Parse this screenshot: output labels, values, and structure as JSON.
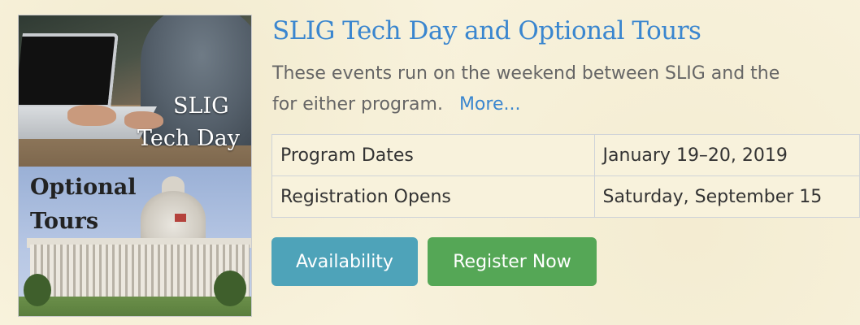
{
  "image_panel": {
    "top_caption_line1": "SLIG",
    "top_caption_line2": "Tech Day",
    "bottom_caption_line1": "Optional",
    "bottom_caption_line2": "Tours"
  },
  "event": {
    "title": "SLIG Tech Day and Optional Tours",
    "description_line1": "These events run on the weekend between SLIG and the",
    "description_line2": "for either program.",
    "more_link": "More..."
  },
  "details_table": {
    "rows": [
      {
        "label": "Program Dates",
        "value": "January 19–20, 2019"
      },
      {
        "label": "Registration Opens",
        "value": "Saturday, September 15"
      }
    ]
  },
  "actions": {
    "availability_label": "Availability",
    "register_label": "Register Now"
  },
  "colors": {
    "link_blue": "#3a86cf",
    "availability_bg": "#4ea3b9",
    "register_bg": "#55a756",
    "page_bg": "#f8f2dc"
  }
}
